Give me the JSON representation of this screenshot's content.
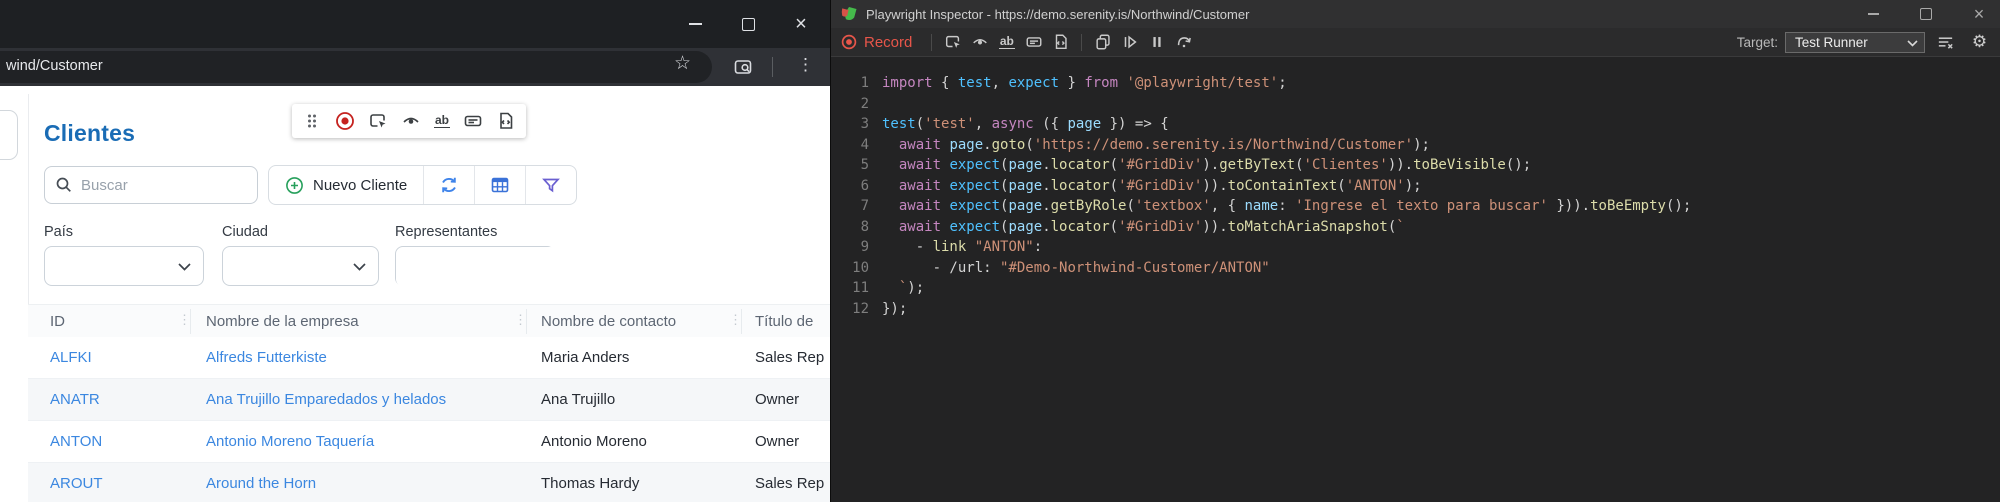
{
  "browser": {
    "address_bar": {
      "url": "wind/Customer"
    },
    "page": {
      "heading": "Clientes",
      "search": {
        "placeholder": "Buscar"
      },
      "toolbar": {
        "new_client": "Nuevo Cliente"
      },
      "filters": {
        "pais": {
          "label": "País"
        },
        "ciudad": {
          "label": "Ciudad"
        },
        "representantes": {
          "label": "Representantes"
        }
      },
      "table": {
        "headers": [
          "ID",
          "Nombre de la empresa",
          "Nombre de contacto",
          "Título de"
        ],
        "rows": [
          {
            "id": "ALFKI",
            "company": "Alfreds Futterkiste",
            "contact": "Maria Anders",
            "title": "Sales Rep"
          },
          {
            "id": "ANATR",
            "company": "Ana Trujillo Emparedados y helados",
            "contact": "Ana Trujillo",
            "title": "Owner"
          },
          {
            "id": "ANTON",
            "company": "Antonio Moreno Taquería",
            "contact": "Antonio Moreno",
            "title": "Owner"
          },
          {
            "id": "AROUT",
            "company": "Around the Horn",
            "contact": "Thomas Hardy",
            "title": "Sales Rep"
          }
        ]
      },
      "overlay_toolbar": {
        "icons": [
          "drag-handle",
          "record",
          "pick-locator",
          "assert-visibility",
          "assert-text",
          "assert-value",
          "assert-snapshot"
        ]
      }
    }
  },
  "inspector": {
    "title": "Playwright Inspector - https://demo.serenity.is/Northwind/Customer",
    "toolbar": {
      "record": "Record",
      "target_label": "Target:",
      "target_value": "Test Runner",
      "icons": [
        "pick-locator",
        "assert-visibility",
        "assert-text",
        "assert-value",
        "assert-snapshot",
        "copy",
        "resume",
        "pause",
        "step-over",
        "clear",
        "settings"
      ]
    },
    "code": {
      "lines": [
        {
          "n": 1,
          "tokens": [
            [
              "kw",
              "import"
            ],
            [
              "pl",
              " { "
            ],
            [
              "bl",
              "test"
            ],
            [
              "pl",
              ", "
            ],
            [
              "bl",
              "expect"
            ],
            [
              "pl",
              " } "
            ],
            [
              "kw",
              "from"
            ],
            [
              "pl",
              " "
            ],
            [
              "st",
              "'@playwright/test'"
            ],
            [
              "pl",
              ";"
            ]
          ]
        },
        {
          "n": 2,
          "tokens": []
        },
        {
          "n": 3,
          "tokens": [
            [
              "bl",
              "test"
            ],
            [
              "pl",
              "("
            ],
            [
              "st",
              "'test'"
            ],
            [
              "pl",
              ", "
            ],
            [
              "kw",
              "async"
            ],
            [
              "pl",
              " ({ "
            ],
            [
              "lb",
              "page"
            ],
            [
              "pl",
              " }) => {"
            ]
          ]
        },
        {
          "n": 4,
          "tokens": [
            [
              "pl",
              "  "
            ],
            [
              "kw",
              "await"
            ],
            [
              "pl",
              " "
            ],
            [
              "lb",
              "page"
            ],
            [
              "pl",
              "."
            ],
            [
              "fn",
              "goto"
            ],
            [
              "pl",
              "("
            ],
            [
              "st",
              "'https://demo.serenity.is/Northwind/Customer'"
            ],
            [
              "pl",
              ");"
            ]
          ]
        },
        {
          "n": 5,
          "tokens": [
            [
              "pl",
              "  "
            ],
            [
              "kw",
              "await"
            ],
            [
              "pl",
              " "
            ],
            [
              "bl",
              "expect"
            ],
            [
              "pl",
              "("
            ],
            [
              "lb",
              "page"
            ],
            [
              "pl",
              "."
            ],
            [
              "fn",
              "locator"
            ],
            [
              "pl",
              "("
            ],
            [
              "st",
              "'#GridDiv'"
            ],
            [
              "pl",
              ")."
            ],
            [
              "fn",
              "getByText"
            ],
            [
              "pl",
              "("
            ],
            [
              "st",
              "'Clientes'"
            ],
            [
              "pl",
              "))."
            ],
            [
              "fn",
              "toBeVisible"
            ],
            [
              "pl",
              "();"
            ]
          ]
        },
        {
          "n": 6,
          "tokens": [
            [
              "pl",
              "  "
            ],
            [
              "kw",
              "await"
            ],
            [
              "pl",
              " "
            ],
            [
              "bl",
              "expect"
            ],
            [
              "pl",
              "("
            ],
            [
              "lb",
              "page"
            ],
            [
              "pl",
              "."
            ],
            [
              "fn",
              "locator"
            ],
            [
              "pl",
              "("
            ],
            [
              "st",
              "'#GridDiv'"
            ],
            [
              "pl",
              "))."
            ],
            [
              "fn",
              "toContainText"
            ],
            [
              "pl",
              "("
            ],
            [
              "st",
              "'ANTON'"
            ],
            [
              "pl",
              ");"
            ]
          ]
        },
        {
          "n": 7,
          "tokens": [
            [
              "pl",
              "  "
            ],
            [
              "kw",
              "await"
            ],
            [
              "pl",
              " "
            ],
            [
              "bl",
              "expect"
            ],
            [
              "pl",
              "("
            ],
            [
              "lb",
              "page"
            ],
            [
              "pl",
              "."
            ],
            [
              "fn",
              "getByRole"
            ],
            [
              "pl",
              "("
            ],
            [
              "st",
              "'textbox'"
            ],
            [
              "pl",
              ", { "
            ],
            [
              "lb",
              "name"
            ],
            [
              "pl",
              ": "
            ],
            [
              "st",
              "'Ingrese el texto para buscar'"
            ],
            [
              "pl",
              " }))."
            ],
            [
              "fn",
              "toBeEmpty"
            ],
            [
              "pl",
              "();"
            ]
          ]
        },
        {
          "n": 8,
          "tokens": [
            [
              "pl",
              "  "
            ],
            [
              "kw",
              "await"
            ],
            [
              "pl",
              " "
            ],
            [
              "bl",
              "expect"
            ],
            [
              "pl",
              "("
            ],
            [
              "lb",
              "page"
            ],
            [
              "pl",
              "."
            ],
            [
              "fn",
              "locator"
            ],
            [
              "pl",
              "("
            ],
            [
              "st",
              "'#GridDiv'"
            ],
            [
              "pl",
              "))."
            ],
            [
              "fn",
              "toMatchAriaSnapshot"
            ],
            [
              "pl",
              "("
            ],
            [
              "st",
              "`"
            ]
          ]
        },
        {
          "n": 9,
          "tokens": [
            [
              "pl",
              "    - "
            ],
            [
              "fn",
              "link"
            ],
            [
              "pl",
              " "
            ],
            [
              "st",
              "\"ANTON\""
            ],
            [
              "pl",
              ":"
            ]
          ]
        },
        {
          "n": 10,
          "tokens": [
            [
              "pl",
              "      - /url: "
            ],
            [
              "st",
              "\"#Demo-Northwind-Customer/ANTON\""
            ]
          ]
        },
        {
          "n": 11,
          "tokens": [
            [
              "pl",
              "  "
            ],
            [
              "st",
              "`"
            ],
            [
              "pl",
              ");"
            ]
          ]
        },
        {
          "n": 12,
          "tokens": [
            [
              "pl",
              "});"
            ]
          ]
        }
      ]
    }
  },
  "colors": {
    "accent_blue": "#1a6cb5",
    "link_blue": "#3b87e0",
    "record_red": "#e8564a",
    "keyword": "#C586C0",
    "function": "#DCDCAA",
    "string": "#CE9178"
  }
}
